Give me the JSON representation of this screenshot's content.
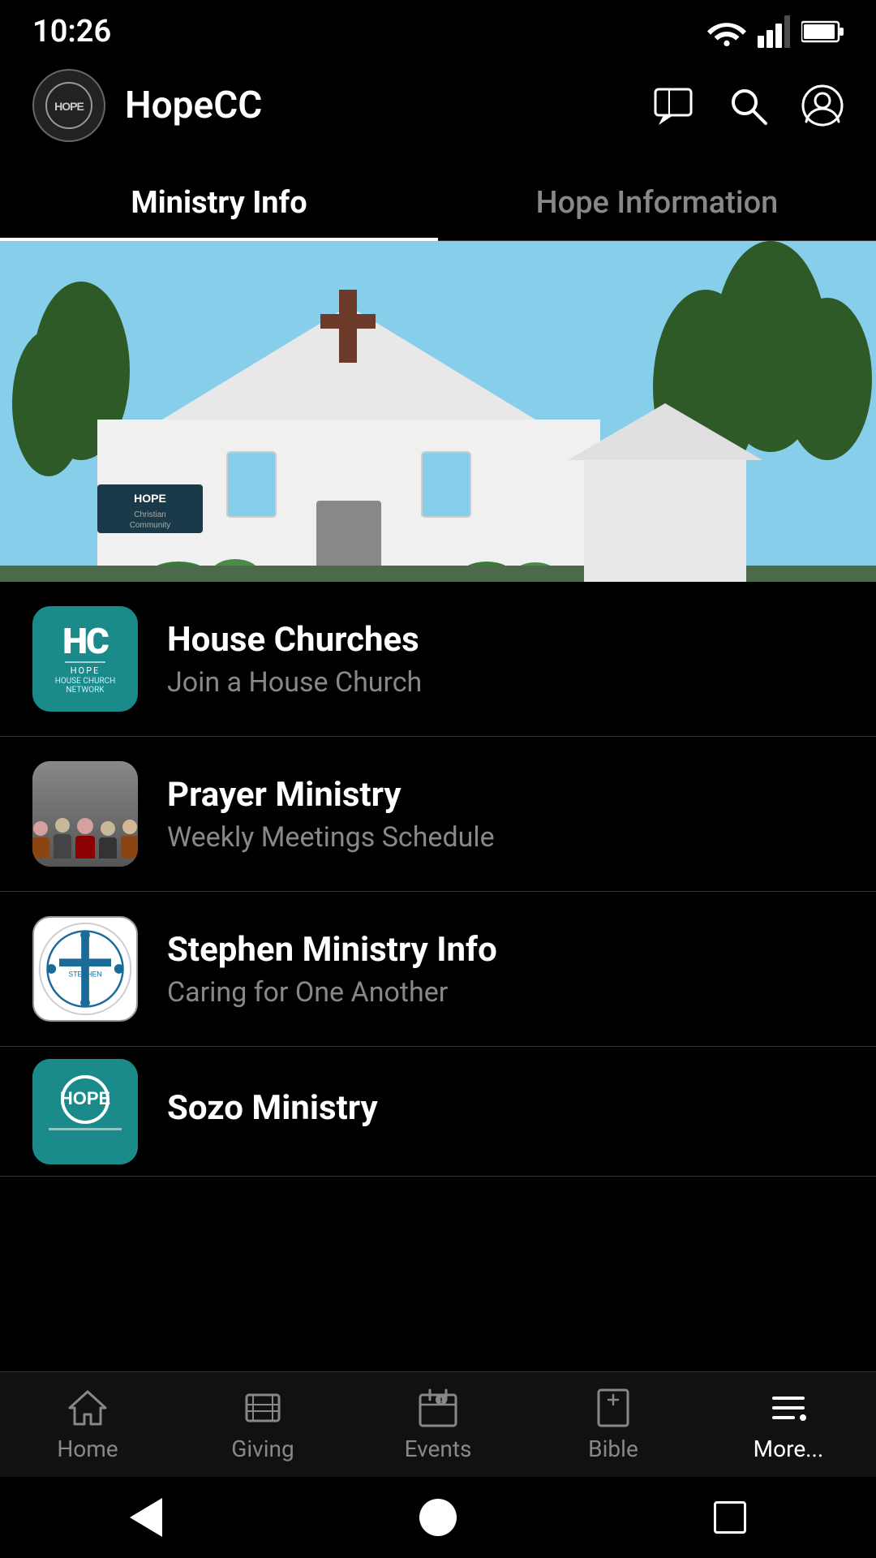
{
  "statusBar": {
    "time": "10:26"
  },
  "header": {
    "logoText": "HOPE",
    "title": "HopeCC"
  },
  "tabs": [
    {
      "id": "ministry-info",
      "label": "Ministry Info",
      "active": true
    },
    {
      "id": "hope-information",
      "label": "Hope Information",
      "active": false
    }
  ],
  "listItems": [
    {
      "id": "house-churches",
      "title": "House Churches",
      "subtitle": "Join a House Church",
      "iconType": "hc"
    },
    {
      "id": "prayer-ministry",
      "title": "Prayer Ministry",
      "subtitle": "Weekly Meetings Schedule",
      "iconType": "prayer"
    },
    {
      "id": "stephen-ministry",
      "title": "Stephen Ministry Info",
      "subtitle": "Caring for One Another",
      "iconType": "stephen"
    },
    {
      "id": "sozo-ministry",
      "title": "Sozo Ministry",
      "subtitle": "",
      "iconType": "sozo"
    }
  ],
  "bottomNav": [
    {
      "id": "home",
      "label": "Home",
      "active": false
    },
    {
      "id": "giving",
      "label": "Giving",
      "active": false
    },
    {
      "id": "events",
      "label": "Events",
      "active": false
    },
    {
      "id": "bible",
      "label": "Bible",
      "active": false
    },
    {
      "id": "more",
      "label": "More...",
      "active": true
    }
  ]
}
